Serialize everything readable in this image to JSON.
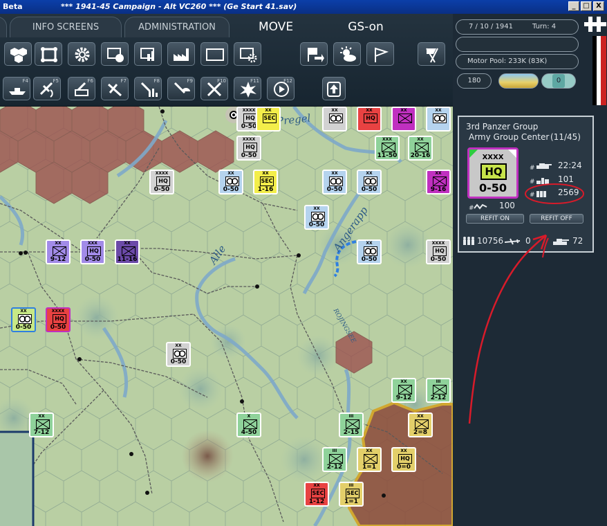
{
  "titlebar": {
    "left": "Beta",
    "title": "***   1941-45 Campaign - Alt VC260   ***   (Ge Start 41.sav)",
    "min": "_",
    "max": "□",
    "close": "X"
  },
  "tabs": {
    "info": "INFO SCREENS",
    "admin": "ADMINISTRATION",
    "move": "MOVE",
    "gs": "GS-on"
  },
  "fkeys": [
    "F4",
    "F5",
    "F6",
    "F7",
    "F8",
    "F9",
    "F10",
    "F11",
    "F12"
  ],
  "status": {
    "date": "7 / 10 / 1941",
    "turn": "Turn: 4",
    "motor_pool": "Motor Pool:  233K (83K)",
    "value": "180",
    "zero": "0"
  },
  "unit_info": {
    "name": "3rd Panzer Group",
    "parent": "Army Group Center",
    "count": "(11/45)",
    "size": "XXXX",
    "type": "HQ",
    "strength": "0-50",
    "tanks": "22:24",
    "guns": "101",
    "trucks": "2569",
    "supply": "100",
    "refit_on": "REFIT ON",
    "refit_off": "REFIT OFF",
    "men": "10756",
    "aircraft": "0",
    "afv": "72"
  },
  "map_labels": {
    "pregel": "Pregel",
    "angerapp": "Angerapp",
    "alle": "Alle",
    "rojingsee": "ROJINGSEE"
  },
  "counters": [
    {
      "size": "XXXX",
      "kind": "HQ",
      "label": "HQ",
      "str": "0-50",
      "color": "#d2d2d2",
      "border": "#ffffff"
    },
    {
      "size": "XX",
      "kind": "sec",
      "label": "SEC",
      "str": "",
      "color": "#f3ee4a",
      "border": "#ffffff"
    },
    {
      "size": "XXX",
      "kind": "inf",
      "label": "",
      "str": "11-50",
      "color": "#8fd29a",
      "border": "#ffffff"
    },
    {
      "size": "XX",
      "kind": "inf",
      "label": "",
      "str": "20-16",
      "color": "#8fd29a",
      "border": "#ffffff"
    },
    {
      "size": "XXXX",
      "kind": "HQ",
      "label": "HQ",
      "str": "0-50",
      "color": "#d2d2d2",
      "border": "#ffffff"
    },
    {
      "size": "XX",
      "kind": "mot",
      "label": "",
      "str": "0-50",
      "color": "#b5d3ee",
      "border": "#ffffff"
    },
    {
      "size": "XX",
      "kind": "sec",
      "label": "SEC",
      "str": "1-16",
      "color": "#f3ee4a",
      "border": "#ffffff"
    },
    {
      "size": "XX",
      "kind": "mot",
      "label": "",
      "str": "0-50",
      "color": "#b5d3ee",
      "border": "#ffffff"
    },
    {
      "size": "XXXX",
      "kind": "HQ",
      "label": "HQ",
      "str": "0-50",
      "color": "#d2d2d2",
      "border": "#ffffff"
    },
    {
      "size": "XX",
      "kind": "mot",
      "label": "",
      "str": "0-50",
      "color": "#b5d3ee",
      "border": "#ffffff"
    },
    {
      "size": "XX",
      "kind": "inf",
      "label": "",
      "str": "9-12",
      "color": "#a28be8",
      "border": "#ffffff"
    },
    {
      "size": "XXX",
      "kind": "HQ",
      "label": "HQ",
      "str": "0-50",
      "color": "#a28be8",
      "border": "#ffffff"
    },
    {
      "size": "XX",
      "kind": "inf",
      "label": "",
      "str": "11-16",
      "color": "#6b4aa8",
      "border": "#ffffff"
    },
    {
      "size": "XX",
      "kind": "mot",
      "label": "",
      "str": "0-50",
      "color": "#b5d3ee",
      "border": "#ffffff"
    },
    {
      "size": "XX",
      "kind": "mot",
      "label": "",
      "str": "0-50",
      "color": "#c7e886",
      "border": "#2f7fe0"
    },
    {
      "size": "XXXX",
      "kind": "HQ",
      "label": "HQ",
      "str": "0-50",
      "color": "#e84242",
      "border": "#c030c0"
    },
    {
      "size": "XX",
      "kind": "mot",
      "label": "",
      "str": "0-50",
      "color": "#d2d2d2",
      "border": "#ffffff"
    },
    {
      "size": "XX",
      "kind": "mot",
      "label": "",
      "str": "0-50",
      "color": "#b5d3ee",
      "border": "#ffffff"
    },
    {
      "size": "XXXX",
      "kind": "HQ",
      "label": "HQ",
      "str": "0-50",
      "color": "#d2d2d2",
      "border": "#ffffff"
    },
    {
      "size": "XX",
      "kind": "inf",
      "label": "",
      "str": "9-12",
      "color": "#8fd29a",
      "border": "#ffffff"
    },
    {
      "size": "III",
      "kind": "inf",
      "label": "",
      "str": "2-12",
      "color": "#8fd29a",
      "border": "#ffffff"
    },
    {
      "size": "XX",
      "kind": "inf",
      "label": "",
      "str": "7-12",
      "color": "#8fd29a",
      "border": "#ffffff"
    },
    {
      "size": "X",
      "kind": "inf",
      "label": "",
      "str": "4-50",
      "color": "#8fd29a",
      "border": "#ffffff"
    },
    {
      "size": "III",
      "kind": "inf",
      "label": "",
      "str": "2-15",
      "color": "#8fd29a",
      "border": "#ffffff"
    },
    {
      "size": "XX",
      "kind": "inf",
      "label": "",
      "str": "2=8",
      "color": "#e3cf6a",
      "border": "#ffffff"
    },
    {
      "size": "III",
      "kind": "inf",
      "label": "",
      "str": "2-12",
      "color": "#8fd29a",
      "border": "#ffffff"
    },
    {
      "size": "XX",
      "kind": "inf",
      "label": "",
      "str": "1=1",
      "color": "#e3cf6a",
      "border": "#ffffff"
    },
    {
      "size": "XX",
      "kind": "HQ",
      "label": "HQ",
      "str": "0=0",
      "color": "#e3cf6a",
      "border": "#ffffff"
    },
    {
      "size": "XX",
      "kind": "sec",
      "label": "SEC",
      "str": "1-12",
      "color": "#e84242",
      "border": "#ffffff"
    },
    {
      "size": "III",
      "kind": "sec",
      "label": "SEC",
      "str": "1=1",
      "color": "#e3cf6a",
      "border": "#ffffff"
    },
    {
      "size": "XX",
      "kind": "HQ",
      "label": "HQ",
      "str": "",
      "color": "#e84242",
      "border": "#ffffff"
    },
    {
      "size": "XX",
      "kind": "inf",
      "label": "",
      "str": "",
      "color": "#c030c0",
      "border": "#ffffff"
    },
    {
      "size": "XX",
      "kind": "mot",
      "label": "",
      "str": "",
      "color": "#d2d2d2",
      "border": "#ffffff"
    },
    {
      "size": "XX",
      "kind": "mot",
      "label": "",
      "str": "",
      "color": "#b5d3ee",
      "border": "#ffffff"
    },
    {
      "size": "XX",
      "kind": "inf",
      "label": "",
      "str": "9-16",
      "color": "#c030c0",
      "border": "#ffffff"
    }
  ]
}
